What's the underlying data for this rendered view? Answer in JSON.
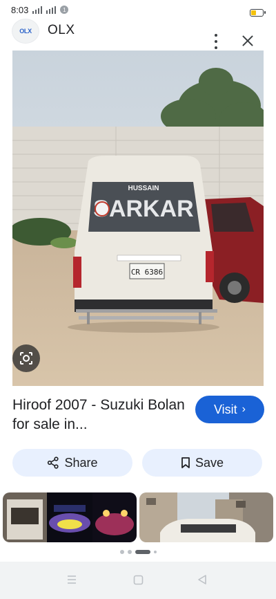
{
  "status_bar": {
    "time": "8:03",
    "notification_count": "1"
  },
  "header": {
    "logo_text": "OLX",
    "site_name": "OLX"
  },
  "main_image": {
    "plate_text": "CR 6386",
    "windshield_text": "SARKAR",
    "banner_text": "HUSSAIN"
  },
  "result": {
    "title": "Hiroof 2007 - Suzuki Bolan for sale in...",
    "visit_label": "Visit"
  },
  "actions": {
    "share_label": "Share",
    "save_label": "Save"
  },
  "colors": {
    "accent": "#1a62d6",
    "chip_bg": "#e8f0fe"
  },
  "pagination": {
    "count": 4,
    "active_index": 2
  }
}
